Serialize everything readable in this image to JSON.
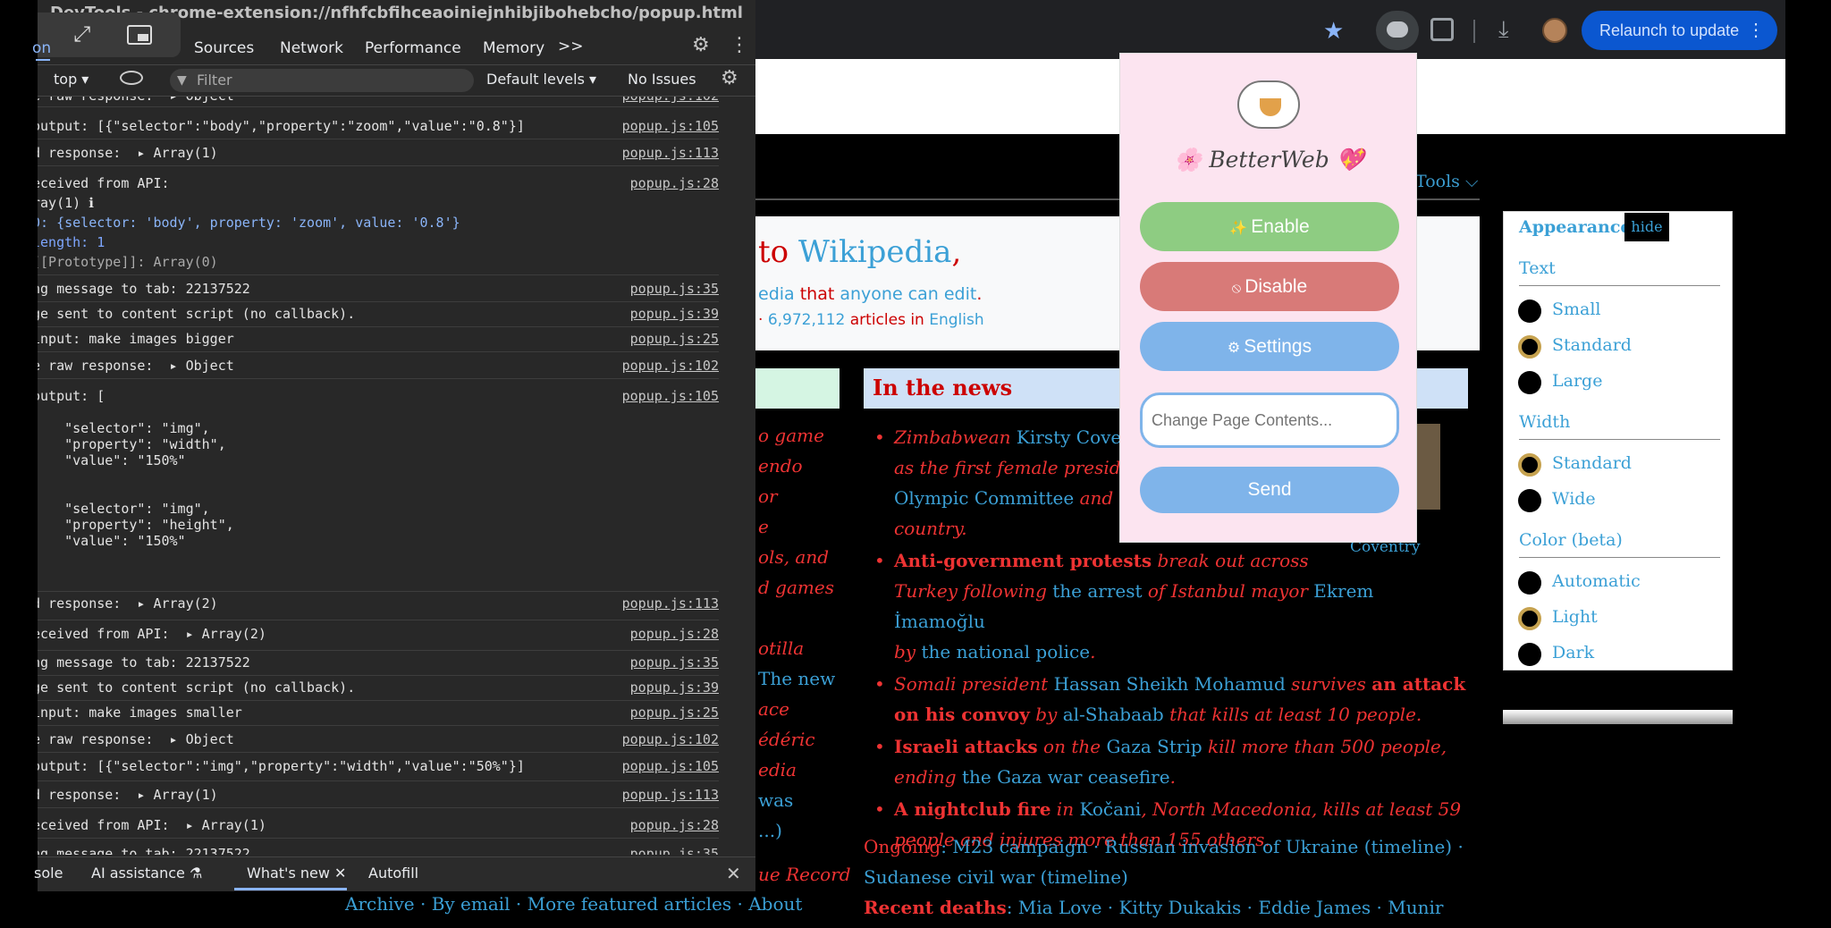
{
  "devtools": {
    "window_title": "DevTools - chrome-extension://nfhfcbfihceaoiniejnhibjibohebcho/popup.html",
    "tabs": [
      {
        "label": "on"
      },
      {
        "label": "Sources"
      },
      {
        "label": "Network"
      },
      {
        "label": "Performance"
      },
      {
        "label": "Memory"
      },
      {
        "label": ">>"
      }
    ],
    "toolbar": {
      "context": "top ▾",
      "filter_placeholder": "Filter",
      "levels": "Default levels ▾",
      "issues": "No Issues"
    },
    "console_rows": [
      {
        "msg": "e raw response:  ▸ Object",
        "src": "popup.js:102"
      },
      {
        "msg": "output: [{\"selector\":\"body\",\"property\":\"zoom\",\"value\":\"0.8\"}]",
        "src": "popup.js:105"
      },
      {
        "msg": "d response:  ▸ Array(1)",
        "src": "popup.js:113"
      },
      {
        "msg": "eceived from API:",
        "src": "popup.js:28"
      },
      {
        "msg": "ray(1) ℹ",
        "src": ""
      },
      {
        "msg": "0: {selector: 'body', property: 'zoom', value: '0.8'}",
        "src": ""
      },
      {
        "msg": "length: 1",
        "src": ""
      },
      {
        "msg": "[[Prototype]]: Array(0)",
        "src": ""
      },
      {
        "msg": "ng message to tab: 22137522",
        "src": "popup.js:35"
      },
      {
        "msg": "ge sent to content script (no callback).",
        "src": "popup.js:39"
      },
      {
        "msg": "input: make images bigger",
        "src": "popup.js:25"
      },
      {
        "msg": "e raw response:  ▸ Object",
        "src": "popup.js:102"
      },
      {
        "msg": "output: [",
        "src": "popup.js:105"
      },
      {
        "msg": "    \"selector\": \"img\",",
        "src": ""
      },
      {
        "msg": "    \"property\": \"width\",",
        "src": ""
      },
      {
        "msg": "    \"value\": \"150%\"",
        "src": ""
      },
      {
        "msg": ",",
        "src": ""
      },
      {
        "msg": "    \"selector\": \"img\",",
        "src": ""
      },
      {
        "msg": "    \"property\": \"height\",",
        "src": ""
      },
      {
        "msg": "    \"value\": \"150%\"",
        "src": ""
      },
      {
        "msg": "d response:  ▸ Array(2)",
        "src": "popup.js:113"
      },
      {
        "msg": "eceived from API:  ▸ Array(2)",
        "src": "popup.js:28"
      },
      {
        "msg": "ng message to tab: 22137522",
        "src": "popup.js:35"
      },
      {
        "msg": "ge sent to content script (no callback).",
        "src": "popup.js:39"
      },
      {
        "msg": "input: make images smaller",
        "src": "popup.js:25"
      },
      {
        "msg": "e raw response:  ▸ Object",
        "src": "popup.js:102"
      },
      {
        "msg": "output: [{\"selector\":\"img\",\"property\":\"width\",\"value\":\"50%\"}]",
        "src": "popup.js:105"
      },
      {
        "msg": "d response:  ▸ Array(1)",
        "src": "popup.js:113"
      },
      {
        "msg": "eceived from API:  ▸ Array(1)",
        "src": "popup.js:28"
      },
      {
        "msg": "ng message to tab: 22137522",
        "src": "popup.js:35"
      }
    ],
    "drawer_tabs": [
      {
        "label": "sole"
      },
      {
        "label": "AI assistance ⚗"
      },
      {
        "label": "What's new ✕"
      },
      {
        "label": "Autofill"
      }
    ]
  },
  "chrome": {
    "relaunch_label": "Relaunch to update"
  },
  "popup": {
    "title": "🌸 BetterWeb 💖",
    "enable_label": "Enable",
    "disable_label": "Disable",
    "settings_label": "Settings",
    "input_placeholder": "Change Page Contents...",
    "send_label": "Send"
  },
  "wiki": {
    "tools": "Tools ⌵",
    "welcome_to": "to ",
    "welcome_wikipedia": "Wikipedia",
    "welcome_comma": ",",
    "welcome_sub_a": "edia",
    "welcome_sub_b": " that ",
    "welcome_sub_c": "anyone can edit",
    "welcome_sub_d": ".",
    "stats_dot": "· ",
    "stats_count": "6,972,112",
    "stats_mid": " articles in ",
    "stats_lang": "English",
    "left_col": [
      "o game",
      "endo",
      "or",
      "e",
      "ols, and",
      "d games"
    ],
    "left_col_b": [
      "otilla",
      "The new",
      "ace",
      "édéric",
      "edia",
      "was",
      "...)"
    ],
    "left_bottom": "ue Record",
    "news_title": "In the news",
    "news_caption": "Coventry",
    "news": [
      {
        "a": "Zimbabwean ",
        "b": "Kirsty Coven",
        "c": "",
        "line2": "as the first female presid",
        "line3b": "Olympic Committee",
        "line3": " and th",
        "line4": "country."
      },
      {
        "bold": "Anti-government protests",
        "rest": " break out across",
        "l2a": "Turkey following ",
        "l2b": "the arrest",
        "l2c": " of ",
        "l2d": "Istanbul mayor",
        "l2e": " ",
        "l2f": "Ekrem İmamoğlu",
        "l3a": "by ",
        "l3b": "the national police",
        "l3c": "."
      },
      {
        "a": "Somali president ",
        "b": "Hassan Sheikh Mohamud",
        "c": " survives ",
        "bold": "an attack on his convoy",
        "d": " by ",
        "e": "al-Shabaab",
        "f": " that kills at least 10 people."
      },
      {
        "bold": "Israeli attacks",
        "a": " on the ",
        "b": "Gaza Strip",
        "c": " kill more than 500 people, ending ",
        "d": "the Gaza war ceasefire",
        "e": "."
      },
      {
        "bold": "A nightclub fire",
        "a": " in ",
        "b": "Kočani",
        "c": ", ",
        "d": "North Macedonia",
        "e": ", kills at least 59 people and injures more than 155 others."
      }
    ],
    "ongoing_label": "Ongoing",
    "ongoing_items": ": M23 campaign · Russian invasion of Ukraine (timeline) ·",
    "ongoing_line2": "Sudanese civil war (timeline)",
    "recent_label": "Recent deaths",
    "recent_items": ": Mia Love · Kitty Dukakis · Eddie James · Munir",
    "bottom_links": "Archive · By email · More featured articles · About"
  },
  "appearance": {
    "title": "Appearance",
    "hide_label": "hide",
    "text_title": "Text",
    "text_options": [
      "Small",
      "Standard",
      "Large"
    ],
    "width_title": "Width",
    "width_options": [
      "Standard",
      "Wide"
    ],
    "color_title": "Color (beta)",
    "color_options": [
      "Automatic",
      "Light",
      "Dark"
    ]
  }
}
